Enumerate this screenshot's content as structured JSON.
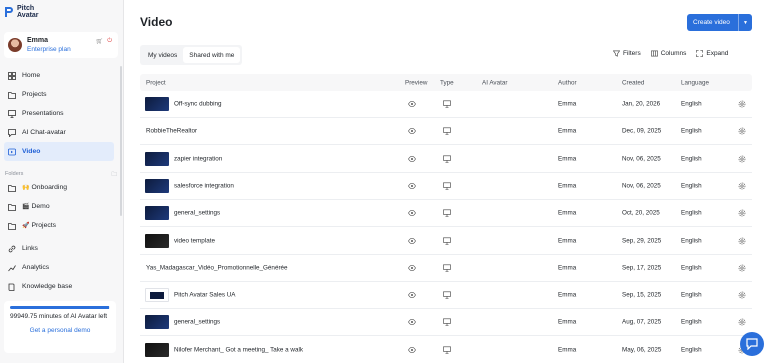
{
  "brand": {
    "name_line1": "Pitch",
    "name_line2": "Avatar"
  },
  "user": {
    "name": "Emma",
    "plan": "Enterprise plan"
  },
  "nav": [
    {
      "label": "Home",
      "icon": "home-icon"
    },
    {
      "label": "Projects",
      "icon": "projects-icon"
    },
    {
      "label": "Presentations",
      "icon": "presentation-icon"
    },
    {
      "label": "AI Chat-avatar",
      "icon": "chat-avatar-icon"
    },
    {
      "label": "Video",
      "icon": "video-icon"
    }
  ],
  "folders": {
    "header": "Folders",
    "items": [
      {
        "emoji": "🙌",
        "label": "Onboarding"
      },
      {
        "emoji": "🎬",
        "label": "Demo"
      },
      {
        "emoji": "🚀",
        "label": "Projects"
      }
    ]
  },
  "nav_bottom": [
    {
      "label": "Links",
      "icon": "link-icon"
    },
    {
      "label": "Analytics",
      "icon": "analytics-icon"
    },
    {
      "label": "Knowledge base",
      "icon": "book-icon"
    }
  ],
  "minutes": {
    "text": "99949.75 minutes of AI Avatar left",
    "progress": 0.99,
    "link": "Get a personal demo"
  },
  "page": {
    "title": "Video",
    "create_label": "Create video"
  },
  "tabs": [
    "My videos",
    "Shared with me"
  ],
  "toolbar": {
    "filters": "Filters",
    "columns": "Columns",
    "expand": "Expand"
  },
  "columns": {
    "project": "Project",
    "preview": "Preview",
    "type": "Type",
    "ai_avatar": "AI Avatar",
    "author": "Author",
    "created": "Created",
    "language": "Language"
  },
  "rows": [
    {
      "name": "Off-sync dubbing",
      "thumb": "blue",
      "author": "Emma",
      "created": "Jan, 20, 2026",
      "language": "English"
    },
    {
      "name": "RobbieTheRealtor",
      "thumb": "",
      "author": "Emma",
      "created": "Dec, 09, 2025",
      "language": "English"
    },
    {
      "name": "zapier integration",
      "thumb": "blue",
      "author": "Emma",
      "created": "Nov, 06, 2025",
      "language": "English"
    },
    {
      "name": "salesforce integration",
      "thumb": "blue",
      "author": "Emma",
      "created": "Nov, 06, 2025",
      "language": "English"
    },
    {
      "name": "general_settings",
      "thumb": "blue",
      "author": "Emma",
      "created": "Oct, 20, 2025",
      "language": "English"
    },
    {
      "name": "video template",
      "thumb": "dark",
      "author": "Emma",
      "created": "Sep, 29, 2025",
      "language": "English"
    },
    {
      "name": "Yas_Madagascar_Vidéo_Promotionnelle_Générée",
      "thumb": "",
      "author": "Emma",
      "created": "Sep, 17, 2025",
      "language": "English"
    },
    {
      "name": "Pitch Avatar Sales UA",
      "thumb": "white",
      "author": "Emma",
      "created": "Sep, 15, 2025",
      "language": "English"
    },
    {
      "name": "general_settings",
      "thumb": "blue",
      "author": "Emma",
      "created": "Aug, 07, 2025",
      "language": "English"
    },
    {
      "name": "Nilofer Merchant_ Got a meeting_ Take a walk",
      "thumb": "dark",
      "author": "Emma",
      "created": "May, 06, 2025",
      "language": "English"
    }
  ]
}
